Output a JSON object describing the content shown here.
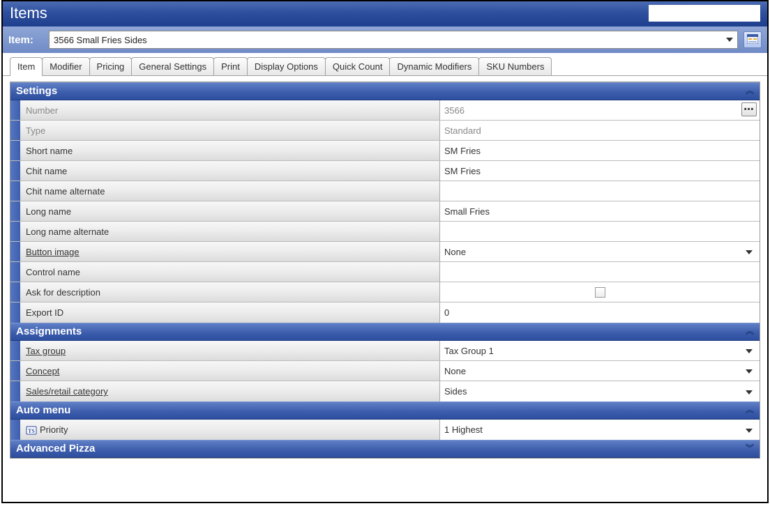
{
  "window": {
    "title": "Items"
  },
  "item_selector": {
    "label": "Item:",
    "value": "3566 Small Fries Sides"
  },
  "tabs": [
    {
      "id": "item",
      "label": "Item",
      "active": true
    },
    {
      "id": "modifier",
      "label": "Modifier",
      "active": false
    },
    {
      "id": "pricing",
      "label": "Pricing",
      "active": false
    },
    {
      "id": "general",
      "label": "General Settings",
      "active": false
    },
    {
      "id": "print",
      "label": "Print",
      "active": false
    },
    {
      "id": "display",
      "label": "Display Options",
      "active": false
    },
    {
      "id": "quickcount",
      "label": "Quick Count",
      "active": false
    },
    {
      "id": "dynmod",
      "label": "Dynamic Modifiers",
      "active": false
    },
    {
      "id": "sku",
      "label": "SKU Numbers",
      "active": false
    }
  ],
  "sections": {
    "settings": {
      "title": "Settings",
      "rows": {
        "number": {
          "label": "Number",
          "value": "3566",
          "readonly": true,
          "ellipsis": true
        },
        "type": {
          "label": "Type",
          "value": "Standard",
          "readonly": true
        },
        "short_name": {
          "label": "Short name",
          "value": "SM Fries"
        },
        "chit_name": {
          "label": "Chit name",
          "value": "SM Fries"
        },
        "chit_alt": {
          "label": "Chit name alternate",
          "value": ""
        },
        "long_name": {
          "label": "Long name",
          "value": "Small Fries"
        },
        "long_alt": {
          "label": "Long name alternate",
          "value": ""
        },
        "button_img": {
          "label": "Button image",
          "value": "None",
          "link": true,
          "dropdown": true
        },
        "ctrl_name": {
          "label": "Control name",
          "value": ""
        },
        "ask_desc": {
          "label": "Ask for description",
          "checked": false,
          "checkbox": true
        },
        "export_id": {
          "label": "Export ID",
          "value": "0"
        }
      }
    },
    "assignments": {
      "title": "Assignments",
      "rows": {
        "tax_group": {
          "label": "Tax group",
          "value": "Tax Group 1",
          "link": true,
          "dropdown": true
        },
        "concept": {
          "label": "Concept",
          "value": "None",
          "link": true,
          "dropdown": true
        },
        "sales_cat": {
          "label": "Sales/retail category",
          "value": "Sides",
          "link": true,
          "dropdown": true
        }
      }
    },
    "auto_menu": {
      "title": "Auto menu",
      "rows": {
        "priority": {
          "label": "Priority",
          "value": "1 Highest",
          "dropdown": true,
          "icon": "ts"
        }
      }
    },
    "adv_pizza": {
      "title": "Advanced Pizza"
    }
  }
}
